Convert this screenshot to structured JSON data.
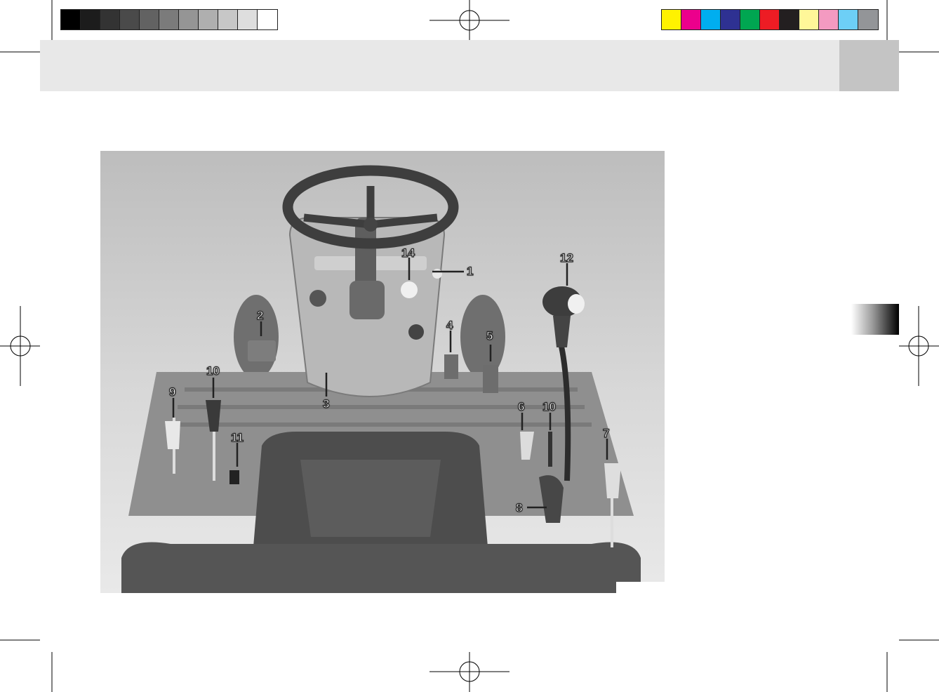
{
  "colors": {
    "grayscale_bar": [
      "#000000",
      "#1c1c1c",
      "#333333",
      "#4a4a4a",
      "#626262",
      "#7b7b7b",
      "#959595",
      "#afafaf",
      "#c7c7c7",
      "#dedede",
      "#ffffff"
    ],
    "color_bar": [
      "#fff200",
      "#ec008c",
      "#00aeef",
      "#2e3192",
      "#00a651",
      "#ed1c24",
      "#231f20",
      "#fff799",
      "#f49ac1",
      "#6dcff6",
      "#939598"
    ],
    "header_band": "#e8e8e8",
    "header_tab": "#c4c4c4"
  },
  "figure": {
    "subject": "tractor operator station controls",
    "callouts": [
      {
        "id": "c1",
        "label": "1"
      },
      {
        "id": "c14",
        "label": "14"
      },
      {
        "id": "c12",
        "label": "12"
      },
      {
        "id": "c2",
        "label": "2"
      },
      {
        "id": "c3",
        "label": "3"
      },
      {
        "id": "c4",
        "label": "4"
      },
      {
        "id": "c5",
        "label": "5"
      },
      {
        "id": "c9",
        "label": "9"
      },
      {
        "id": "c10a",
        "label": "10"
      },
      {
        "id": "c11",
        "label": "11"
      },
      {
        "id": "c6",
        "label": "6"
      },
      {
        "id": "c10b",
        "label": "10"
      },
      {
        "id": "c7",
        "label": "7"
      },
      {
        "id": "c8",
        "label": "8"
      }
    ]
  }
}
